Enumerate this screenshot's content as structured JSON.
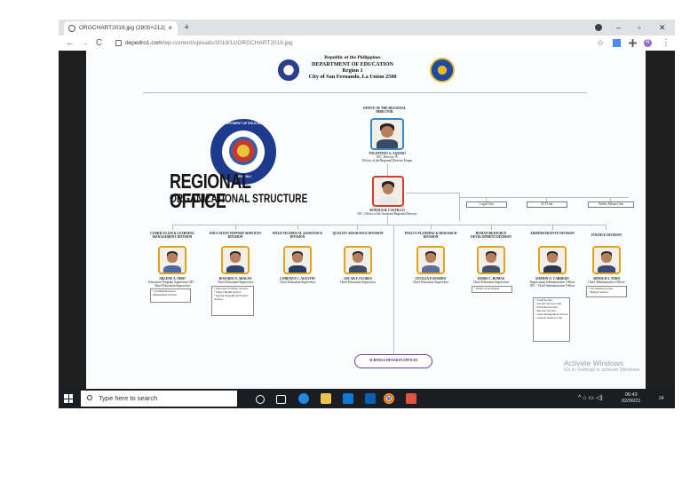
{
  "browser": {
    "tab_title": "ORGCHART2019.jpg (2800×212(",
    "tab_close": "×",
    "new_tab": "+",
    "url_domain": "depedro1.com",
    "url_path": "/wp-content/uploads/2019/11/ORGCHART2019.jpg",
    "nav_back": "←",
    "nav_forward": "→",
    "nav_reload": "C",
    "win_minimize": "–",
    "win_restore": "▫",
    "win_close": "✕",
    "star": "☆",
    "menu": "⋮",
    "profile_initial": "R"
  },
  "document": {
    "header_lines": [
      "Republic of the Philippines",
      "DEPARTMENT OF EDUCATION",
      "Region 1",
      "City of San Fernando, La Union 2500"
    ],
    "title_line1": "REGIONAL OFFICE",
    "title_line2": "ORGANIZATIONAL STRUCTURE",
    "director_office": "OFFICE OF THE REGIONAL DIRECTOR",
    "director_name": "TOLENTINO G. AQUINO",
    "director_role_1": "OIC, Director IV",
    "director_role_2": "Officer of the Regional Director Proper",
    "asst_name": "RONALD B. CASTILLO",
    "asst_role": "OIC, Office of the Assistant Regional Director",
    "units": [
      "Legal Unit",
      "ICT Unit",
      "Public Affairs Unit"
    ],
    "divisions": [
      {
        "title": "CURRICULUM & LEARNING MANAGEMENT DIVISION",
        "name": "ARLENE A. NIRO",
        "role": "Education Program Supervisor OIC - Chief Education Supervisor",
        "items": [
          "Learning Resource Management Section"
        ]
      },
      {
        "title": "EDUCATION SUPPORT SERVICES DIVISION",
        "name": "ROSARIO N. ABALOS",
        "role": "Chief Education Supervisor",
        "items": [
          "Education Facilities Section",
          "School Health Section",
          "Special Programs & Projects Section"
        ]
      },
      {
        "title": "FIELD TECHNICAL ASSISTANCE DIVISION",
        "name": "LORENZO C. AGUSTIN",
        "role": "Chief Education Supervisor",
        "items": []
      },
      {
        "title": "QUALITY ASSURANCE DIVISION",
        "name": "OSCAR F. FLORES",
        "role": "Chief Education Supervisor",
        "items": []
      },
      {
        "title": "POLICY PLANNING & RESEARCH DIVISION",
        "name": "CECILIA P. ROSERO",
        "role": "Chief Education Supervisor",
        "items": []
      },
      {
        "title": "HUMAN RESOURCE DEVELOPMENT DIVISION",
        "name": "DORIS C. ROMAS",
        "role": "Chief Education Supervisor",
        "items": [
          "NEAP of the Region"
        ]
      },
      {
        "title": "ADMINISTRATIVE DIVISION",
        "name": "RAMON O. CABRERO",
        "role": "Supervising Administrative Officer OIC - Chief Administrative Officer",
        "items": [
          "Cash Section",
          "Payroll Services Unit",
          "Personnel Section",
          "Records Section",
          "Asset Management Section",
          "General Services Unit"
        ]
      },
      {
        "title": "FINANCE DIVISION",
        "name": "ARNOLD S. TORO",
        "role": "Chief Administrative Officer",
        "items": [
          "Accounting Section",
          "Budget Section"
        ]
      }
    ],
    "schools_division": "SCHOOLS DIVISION OFFICES",
    "seal_text": "DEPARTMENT OF EDUCATION",
    "seal_region": "REGION I",
    "activate_title": "Activate Windows",
    "activate_sub": "Go to Settings to activate Windows."
  },
  "taskbar": {
    "search_placeholder": "Type here to search",
    "time": "06:43",
    "date": "02/06/21",
    "tray_icons": "^ ⌂ ▭ ◁)",
    "notif": "24"
  }
}
